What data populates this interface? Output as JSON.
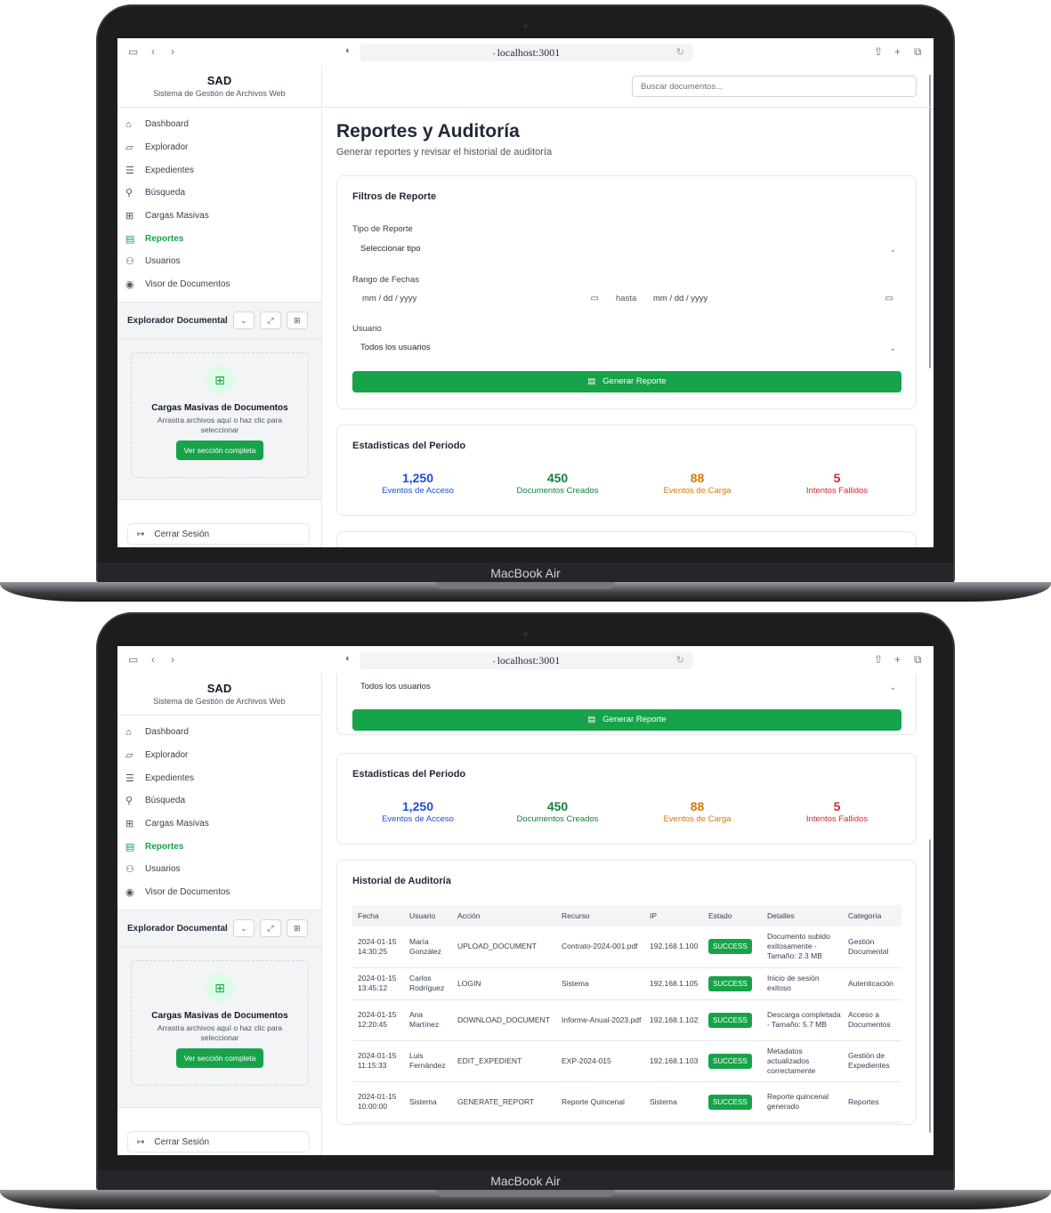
{
  "device": {
    "label": "MacBook Air"
  },
  "browser": {
    "url": "localhost:3001"
  },
  "app": {
    "title": "SAD",
    "subtitle": "Sistema de Gestión de Archivos Web"
  },
  "search": {
    "placeholder": "Buscar documentos..."
  },
  "sidebar": {
    "items": [
      {
        "label": "Dashboard",
        "icon": "home-icon"
      },
      {
        "label": "Explorador",
        "icon": "folder-icon"
      },
      {
        "label": "Expedientes",
        "icon": "database-icon"
      },
      {
        "label": "Búsqueda",
        "icon": "search-icon"
      },
      {
        "label": "Cargas Masivas",
        "icon": "file-upload-icon"
      },
      {
        "label": "Reportes",
        "icon": "clipboard-icon",
        "active": true
      },
      {
        "label": "Usuarios",
        "icon": "users-icon"
      },
      {
        "label": "Visor de Documentos",
        "icon": "eye-icon"
      }
    ],
    "explorer_title": "Explorador Documental",
    "upload": {
      "title": "Cargas Masivas de Documentos",
      "desc": "Arrastra archivos aquí o haz clic para seleccionar",
      "button": "Ver sección completa"
    },
    "logout": "Cerrar Sesión"
  },
  "page": {
    "title": "Reportes y Auditoría",
    "subtitle": "Generar reportes y revisar el historial de auditoría"
  },
  "filters": {
    "title": "Filtros de Reporte",
    "report_type_label": "Tipo de Reporte",
    "report_type_value": "Seleccionar tipo",
    "date_range_label": "Rango de Fechas",
    "date_from": "mm / dd / yyyy",
    "date_to": "mm / dd / yyyy",
    "date_sep": "hasta",
    "user_label": "Usuario",
    "user_value": "Todos los usuarios",
    "generate_button": "Generar Reporte"
  },
  "stats": {
    "title": "Estadisticas del Periodo",
    "items": [
      {
        "value": "1,250",
        "label": "Eventos de Acceso",
        "color": "#1d4ed8"
      },
      {
        "value": "450",
        "label": "Documentos Creados",
        "color": "#15803d"
      },
      {
        "value": "88",
        "label": "Eventos de Carga",
        "color": "#d97706"
      },
      {
        "value": "5",
        "label": "Intentos Fallidos",
        "color": "#dc2626"
      }
    ]
  },
  "audit": {
    "title": "Historial de Auditoría",
    "columns": [
      "Fecha",
      "Usuario",
      "Acción",
      "Recurso",
      "IP",
      "Estado",
      "Detalles",
      "Categoría"
    ],
    "rows": [
      {
        "fecha": "2024-01-15 14:30:25",
        "usuario": "María González",
        "accion": "UPLOAD_DOCUMENT",
        "recurso": "Contrato-2024-001.pdf",
        "ip": "192.168.1.100",
        "estado": "SUCCESS",
        "detalles": "Documento subido exitosamente - Tamaño: 2.3 MB",
        "categoria": "Gestión Documental"
      },
      {
        "fecha": "2024-01-15 13:45:12",
        "usuario": "Carlos Rodríguez",
        "accion": "LOGIN",
        "recurso": "Sistema",
        "ip": "192.168.1.105",
        "estado": "SUCCESS",
        "detalles": "Inicio de sesión exitoso",
        "categoria": "Autenticación"
      },
      {
        "fecha": "2024-01-15 12:20:45",
        "usuario": "Ana Martínez",
        "accion": "DOWNLOAD_DOCUMENT",
        "recurso": "Informe-Anual-2023.pdf",
        "ip": "192.168.1.102",
        "estado": "SUCCESS",
        "detalles": "Descarga completada - Tamaño: 5.7 MB",
        "categoria": "Acceso a Documentos"
      },
      {
        "fecha": "2024-01-15 11:15:33",
        "usuario": "Luis Fernández",
        "accion": "EDIT_EXPEDIENT",
        "recurso": "EXP-2024-015",
        "ip": "192.168.1.103",
        "estado": "SUCCESS",
        "detalles": "Metadatos actualizados correctamente",
        "categoria": "Gestión de Expedientes"
      },
      {
        "fecha": "2024-01-15 10:00:00",
        "usuario": "Sistema",
        "accion": "GENERATE_REPORT",
        "recurso": "Reporte Quincenal",
        "ip": "Sistema",
        "estado": "SUCCESS",
        "detalles": "Reporte quincenal generado",
        "categoria": "Reportes"
      }
    ]
  }
}
